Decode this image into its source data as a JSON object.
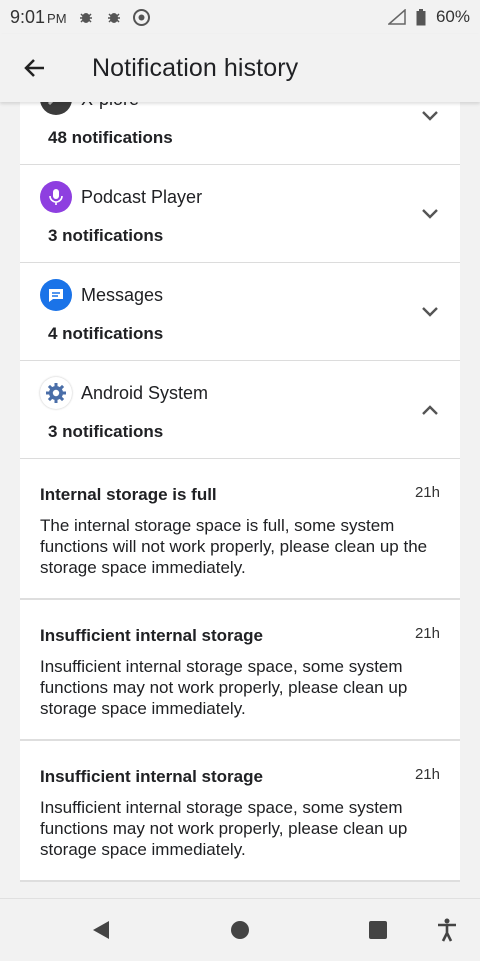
{
  "status_bar": {
    "time": "9:01",
    "ampm": "PM",
    "battery": "60%"
  },
  "header": {
    "title": "Notification history"
  },
  "apps": [
    {
      "name": "X-plore",
      "count": "48 notifications",
      "icon": "xplore-icon",
      "expanded": false
    },
    {
      "name": "Podcast Player",
      "count": "3 notifications",
      "icon": "podcast-icon",
      "expanded": false
    },
    {
      "name": "Messages",
      "count": "4 notifications",
      "icon": "messages-icon",
      "expanded": false
    },
    {
      "name": "Android System",
      "count": "3 notifications",
      "icon": "android-system-gear-icon",
      "expanded": true
    }
  ],
  "notifications": [
    {
      "title": "Internal storage is full",
      "time": "21h",
      "body": "The internal storage space is full, some system functions will not work properly, please clean up the storage space immediately."
    },
    {
      "title": "Insufficient internal storage",
      "time": "21h",
      "body": "Insufficient internal storage space, some system functions may not work properly, please clean up storage space immediately."
    },
    {
      "title": "Insufficient internal storage",
      "time": "21h",
      "body": "Insufficient internal storage space, some system functions may not work properly, please clean up storage space immediately."
    }
  ],
  "colors": {
    "podcast": "#8e3fe0",
    "messages": "#1a73e8",
    "gear": "#4a6ea8"
  }
}
